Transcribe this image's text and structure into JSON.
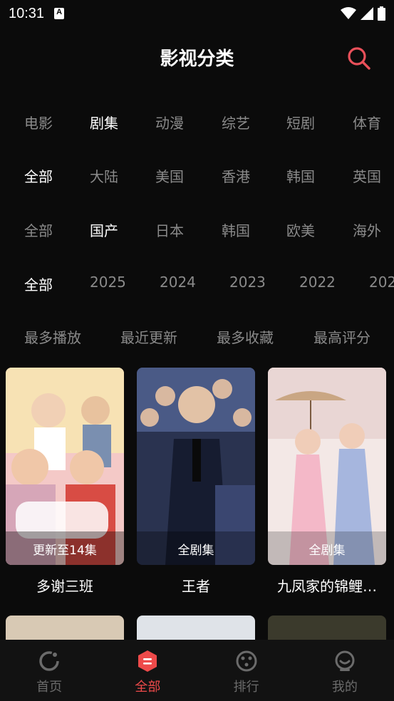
{
  "status_bar": {
    "time": "10:31"
  },
  "header": {
    "title": "影视分类",
    "search_icon": "search-icon"
  },
  "filters": {
    "type": {
      "items": [
        "电影",
        "剧集",
        "动漫",
        "综艺",
        "短剧",
        "体育"
      ],
      "active": "剧集"
    },
    "region": {
      "items": [
        "全部",
        "大陆",
        "美国",
        "香港",
        "韩国",
        "英国"
      ],
      "active": "全部"
    },
    "sub": {
      "items": [
        "全部",
        "国产",
        "日本",
        "韩国",
        "欧美",
        "海外"
      ],
      "active": "国产"
    },
    "year": {
      "items": [
        "全部",
        "2025",
        "2024",
        "2023",
        "2022",
        "202"
      ],
      "active": "全部"
    },
    "sort": {
      "items": [
        "最多播放",
        "最近更新",
        "最多收藏",
        "最高评分"
      ],
      "active": ""
    }
  },
  "cards": [
    {
      "title": "多谢三班",
      "badge": "更新至14集"
    },
    {
      "title": "王者",
      "badge": "全剧集"
    },
    {
      "title": "九凤家的锦鲤…",
      "badge": "全剧集"
    }
  ],
  "tabbar": {
    "items": [
      {
        "label": "首页",
        "icon": "home-icon"
      },
      {
        "label": "全部",
        "icon": "category-icon"
      },
      {
        "label": "排行",
        "icon": "rank-icon"
      },
      {
        "label": "我的",
        "icon": "profile-icon"
      }
    ],
    "active": "全部"
  },
  "colors": {
    "accent": "#ee4a4a",
    "background": "#0b0b0b",
    "inactive": "#8a8a8a"
  }
}
